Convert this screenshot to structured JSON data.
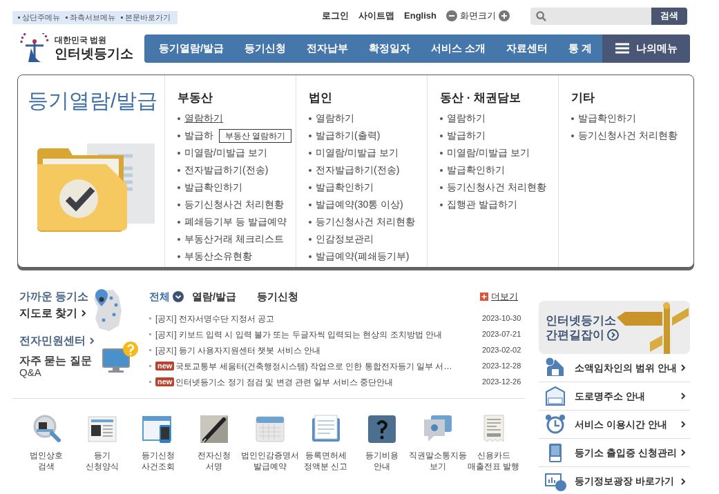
{
  "skip_links": [
    "상단주메뉴",
    "좌측서브메뉴",
    "본문바로가기"
  ],
  "utility_links": [
    "로그인",
    "사이트맵",
    "English"
  ],
  "font_size": {
    "label": "화면크기"
  },
  "search": {
    "button": "검색"
  },
  "logo": {
    "top": "대한민국 법원",
    "name": "인터넷등기소"
  },
  "nav": {
    "items": [
      "등기열람/발급",
      "등기신청",
      "전자납부",
      "확정일자",
      "서비스 소개",
      "자료센터",
      "통 계"
    ],
    "my_menu": "나의메뉴"
  },
  "dropdown": {
    "title": "등기열람/발급",
    "tooltip": "부동산 열람하기",
    "columns": [
      {
        "heading": "부동산",
        "items": [
          {
            "label": "열람하기",
            "hovered": true
          },
          {
            "label": "발급하",
            "hovered": false
          },
          {
            "label": "미열람/미발급 보기",
            "hovered": false
          },
          {
            "label": "전자발급하기(전송)",
            "hovered": false
          },
          {
            "label": "발급확인하기",
            "hovered": false
          },
          {
            "label": "등기신청사건 처리현황",
            "hovered": false
          },
          {
            "label": "폐쇄등기부 등 발급예약",
            "hovered": false
          },
          {
            "label": "부동산거래 체크리스트",
            "hovered": false
          },
          {
            "label": "부동산소유현황",
            "hovered": false
          }
        ]
      },
      {
        "heading": "법인",
        "items": [
          {
            "label": "열람하기",
            "hovered": false
          },
          {
            "label": "발급하기(출력)",
            "hovered": false
          },
          {
            "label": "미열람/미발급 보기",
            "hovered": false
          },
          {
            "label": "전자발급하기(전송)",
            "hovered": false
          },
          {
            "label": "발급확인하기",
            "hovered": false
          },
          {
            "label": "발급예약(30통 이상)",
            "hovered": false
          },
          {
            "label": "등기신청사건 처리현황",
            "hovered": false
          },
          {
            "label": "인감정보관리",
            "hovered": false
          },
          {
            "label": "발급예약(폐쇄등기부)",
            "hovered": false
          }
        ]
      },
      {
        "heading": "동산 · 채권담보",
        "items": [
          {
            "label": "열람하기",
            "hovered": false
          },
          {
            "label": "발급하기",
            "hovered": false
          },
          {
            "label": "미열람/미발급 보기",
            "hovered": false
          },
          {
            "label": "발급확인하기",
            "hovered": false
          },
          {
            "label": "등기신청사건 처리현황",
            "hovered": false
          },
          {
            "label": "집행관 발급하기",
            "hovered": false
          }
        ]
      },
      {
        "heading": "기타",
        "items": [
          {
            "label": "발급확인하기",
            "hovered": false
          },
          {
            "label": "등기신청사건 처리현황",
            "hovered": false
          }
        ]
      }
    ]
  },
  "map_finder": {
    "title": "가까운 등기소",
    "link": "지도로 찾기"
  },
  "e_center": {
    "link": "전자민원센터",
    "faq": "자주 묻는 질문",
    "faq_sub": "Q&A"
  },
  "notices": {
    "tabs": [
      {
        "label": "전체",
        "selected": true
      },
      {
        "label": "열람/발급",
        "selected": false
      },
      {
        "label": "등기신청",
        "selected": false
      }
    ],
    "more": "더보기",
    "rows": [
      {
        "kind": "notice",
        "tag": "[공지]",
        "title": "전자서명수단 지정서 공고",
        "date": "2023-10-30"
      },
      {
        "kind": "notice",
        "tag": "[공지]",
        "title": "키보드 입력 시 입력 불가 또는 두글자씩 입력되는 현상의 조치방법 안내",
        "date": "2023-07-21"
      },
      {
        "kind": "notice",
        "tag": "[공지]",
        "title": "등기 사용자지원센터 챗봇 서비스 안내",
        "date": "2023-02-02"
      },
      {
        "kind": "new",
        "tag": "new",
        "title": "국토교통부 세움터(건축행정시스템) 작업으로 인한 통합전자등기 일부 서…",
        "date": "2023-12-28"
      },
      {
        "kind": "new",
        "tag": "new",
        "title": "인터넷등기소 정기 점검 및 변경 관련 일부 서비스 중단안내",
        "date": "2023-12-26"
      }
    ]
  },
  "banner": {
    "line1": "인터넷등기소",
    "line2": "간편길잡이"
  },
  "info_links": [
    "소액임차인의 범위 안내",
    "도로명주소 안내",
    "서비스 이용시간 안내",
    "등기소 출입증 신청관리",
    "등기정보광장 바로가기"
  ],
  "services": [
    {
      "lines": [
        "법인상호",
        "검색"
      ]
    },
    {
      "lines": [
        "등기",
        "신청양식"
      ]
    },
    {
      "lines": [
        "등기신청",
        "사건조회"
      ]
    },
    {
      "lines": [
        "전자신청",
        "서명"
      ]
    },
    {
      "lines": [
        "법인인감증명서",
        "발급예약"
      ]
    },
    {
      "lines": [
        "등록면허세",
        "정액분 신고"
      ]
    },
    {
      "lines": [
        "등기비용",
        "안내"
      ]
    },
    {
      "lines": [
        "직권말소통지등",
        "보기"
      ]
    },
    {
      "lines": [
        "신용카드",
        "매출전표 발행"
      ]
    }
  ]
}
